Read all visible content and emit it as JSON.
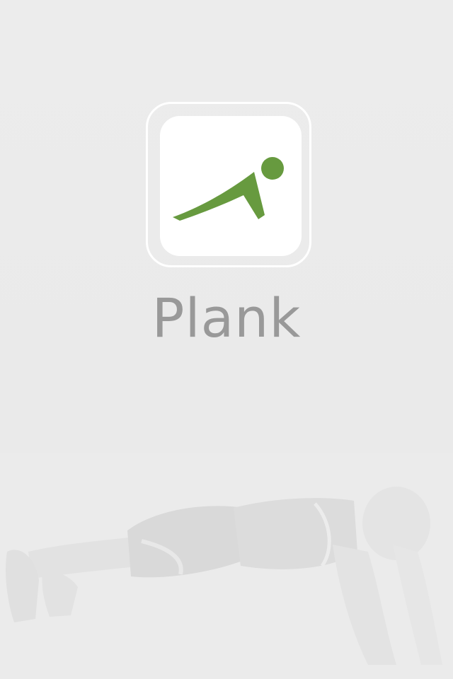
{
  "splash": {
    "app_name": "Plank",
    "icon": "plank-figure-icon",
    "background_image": "person-doing-plank-illustration",
    "colors": {
      "background": "#ebebeb",
      "icon_green": "#679a3f",
      "title_gray": "#999999"
    }
  }
}
